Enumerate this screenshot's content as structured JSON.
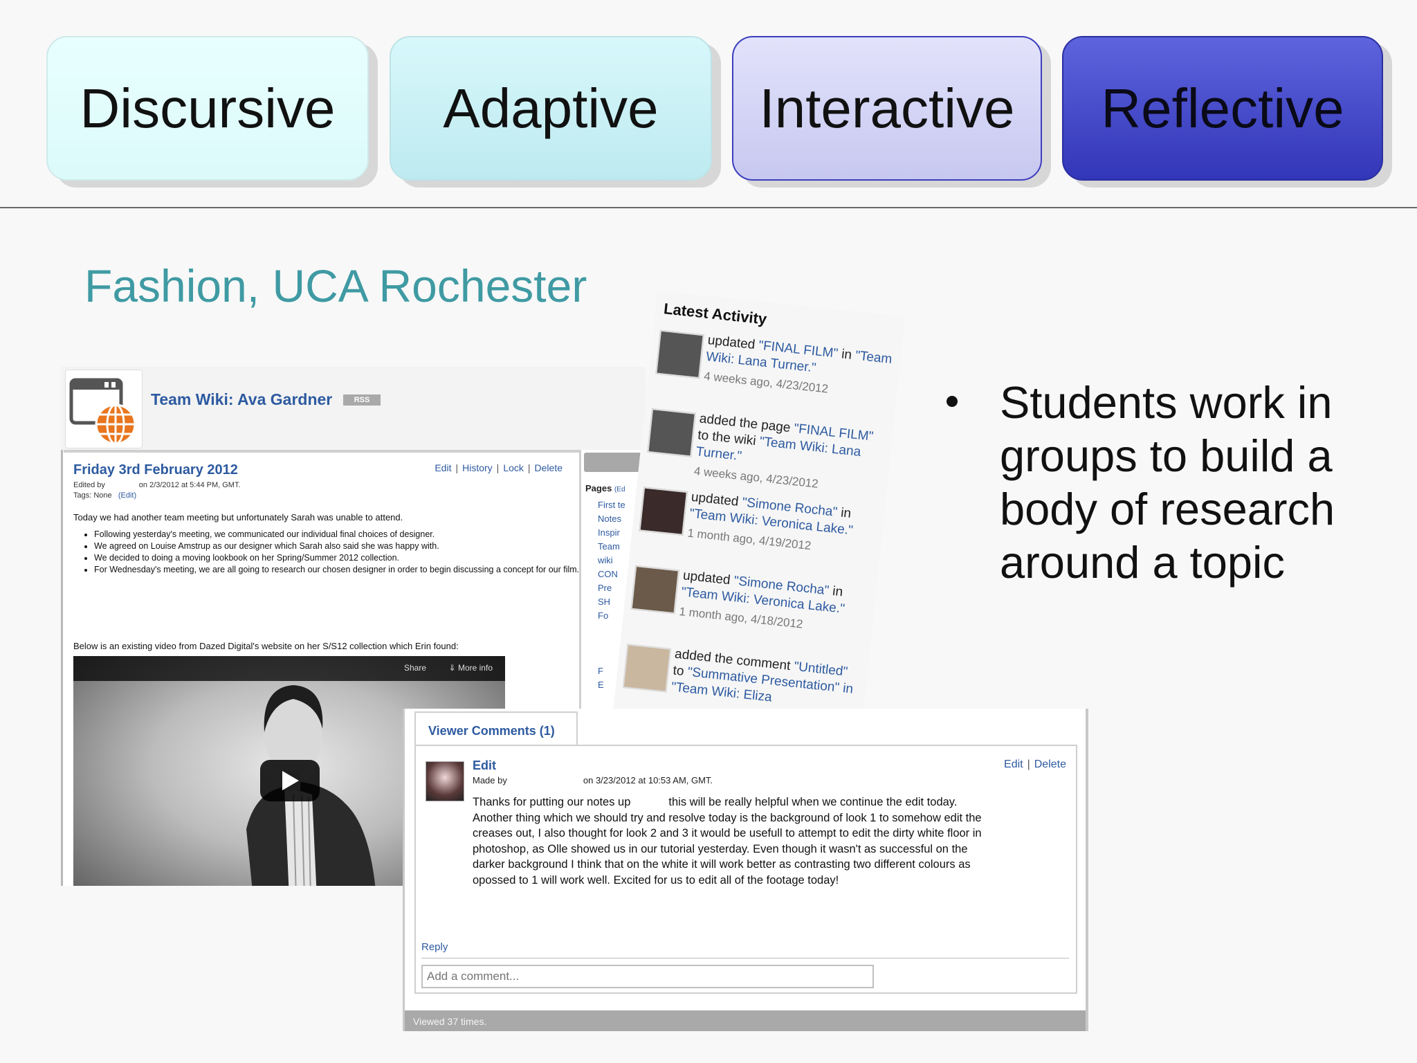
{
  "stages": [
    {
      "label": "Discursive"
    },
    {
      "label": "Adaptive"
    },
    {
      "label": "Interactive"
    },
    {
      "label": "Reflective"
    }
  ],
  "headline": "Fashion, UCA Rochester",
  "bullet": "Students work in groups to build a body of research around a topic",
  "wiki": {
    "title": "Team Wiki: Ava Gardner",
    "rss_label": "RSS",
    "post": {
      "title": "Friday 3rd February 2012",
      "links": [
        "Edit",
        "History",
        "Lock",
        "Delete"
      ],
      "edited_by": "Edited by",
      "edited_on": "on 2/3/2012 at 5:44 PM, GMT.",
      "tags": "Tags: None",
      "tags_edit": "(Edit)",
      "intro": "Today we had another team meeting but unfortunately Sarah was unable to attend.",
      "bullets": [
        "Following yesterday's meeting, we communicated our individual final choices of designer.",
        "We agreed on Louise Amstrup as our designer which Sarah also said she was happy with.",
        "We decided to doing a moving lookbook on her Spring/Summer 2012 collection.",
        "For Wednesday's meeting, we are all going to research our chosen designer in order to begin discussing a concept for our film."
      ],
      "below": "Below is an existing video from Dazed Digital's website on her S/S12 collection which Erin found:"
    },
    "video": {
      "share": "Share",
      "more_info": "More info"
    },
    "sidebar": {
      "pages_label": "Pages",
      "pages_edit": "(Ed",
      "items": [
        "First te",
        "Notes",
        "Inspir",
        "Team",
        "wiki",
        "CON",
        "Pre",
        "SH",
        "Fo",
        "F",
        "E"
      ]
    }
  },
  "activity": {
    "title": "Latest Activity",
    "items": [
      {
        "action": "updated",
        "target": "\"FINAL FILM\"",
        "in": "in",
        "place": "\"Team Wiki: Lana Turner.\"",
        "time": "4 weeks ago, 4/23/2012"
      },
      {
        "action": "added the page",
        "target": "\"FINAL FILM\"",
        "in": "to the wiki",
        "place": "\"Team Wiki: Lana Turner.\"",
        "time": "4 weeks ago, 4/23/2012"
      },
      {
        "action": "updated",
        "target": "\"Simone Rocha\"",
        "in": "in",
        "place": "\"Team Wiki: Veronica Lake.\"",
        "time": "1 month ago, 4/19/2012"
      },
      {
        "action": "updated",
        "target": "\"Simone Rocha\"",
        "in": "in",
        "place": "\"Team Wiki: Veronica Lake.\"",
        "time": "1 month ago, 4/18/2012"
      },
      {
        "action": "added the comment",
        "target": "\"Untitled\"",
        "in": "to",
        "place": "\"Summative Presentation\" in \"Team Wiki: Eliza",
        "time": ""
      }
    ]
  },
  "comments": {
    "tab_label": "Viewer Comments (1)",
    "comment": {
      "author": "Edit",
      "made_by": "Made by",
      "made_on": "on 3/23/2012 at 10:53 AM, GMT.",
      "links": [
        "Edit",
        "Delete"
      ],
      "body_lines": [
        "Thanks for putting our notes up            this will be really helpful when we continue the edit today.",
        "Another thing which we should try and resolve today is the background of look 1 to somehow edit the",
        "creases out, I also thought for look 2 and 3 it would be usefull to attempt to edit the dirty white floor in",
        "photoshop, as Olle showed us in our tutorial yesterday. Even though it wasn't as successful on the",
        "darker background I think that on the white it will work better as contrasting two different colours as",
        "opossed to 1 will work well. Excited for us to edit all of the footage today!"
      ]
    },
    "reply_label": "Reply",
    "input_placeholder": "Add a comment...",
    "viewed": "Viewed 37 times."
  }
}
